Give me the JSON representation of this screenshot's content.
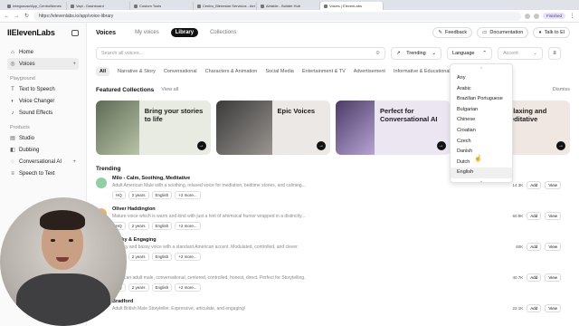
{
  "browser": {
    "tabs": [
      {
        "label": "Integracao/App_CentroBemes"
      },
      {
        "label": "Vapi - Dashboard"
      },
      {
        "label": "Custom Tools"
      },
      {
        "label": "Centro_Bienestar Servicios - Airt"
      },
      {
        "label": "Airtable - Builder Hub"
      },
      {
        "label": "Voices | ElevenLabs"
      }
    ],
    "url": "https://elevenlabs.io/app/voice-library",
    "status_badge": "Finished"
  },
  "sidebar": {
    "brand": "IIElevenLabs",
    "top_items": [
      {
        "label": "Home"
      },
      {
        "label": "Voices"
      }
    ],
    "sections": [
      {
        "label": "Playground",
        "items": [
          {
            "label": "Text to Speech"
          },
          {
            "label": "Voice Changer"
          },
          {
            "label": "Sound Effects"
          }
        ]
      },
      {
        "label": "Products",
        "items": [
          {
            "label": "Studio"
          },
          {
            "label": "Dubbing"
          },
          {
            "label": "Conversational AI"
          },
          {
            "label": "Speech to Text"
          }
        ]
      }
    ]
  },
  "header": {
    "title": "Voices",
    "tabs": [
      {
        "label": "My voices"
      },
      {
        "label": "Library"
      },
      {
        "label": "Collections"
      }
    ],
    "actions": [
      {
        "label": "Feedback"
      },
      {
        "label": "Documentation"
      },
      {
        "label": "Talk to El"
      }
    ]
  },
  "filters": {
    "search_placeholder": "Search all voices...",
    "sort": "Trending",
    "language": "Language",
    "accent": "Accent"
  },
  "categories": [
    "All",
    "Narrative & Story",
    "Conversational",
    "Characters & Animation",
    "Social Media",
    "Entertainment & TV",
    "Advertisement",
    "Informative & Educational"
  ],
  "featured": {
    "title": "Featured Collections",
    "view_all": "View all",
    "dismiss": "Dismiss",
    "cards": [
      {
        "label": "Bring your stories to life",
        "bg": "#e7ebe1"
      },
      {
        "label": "Epic Voices",
        "bg": "#ece8e6"
      },
      {
        "label": "Perfect for Conversational AI",
        "bg": "#ece6f3"
      },
      {
        "label": "Relaxing and Meditative",
        "bg": "#f0e7e2"
      }
    ]
  },
  "trending": {
    "title": "Trending",
    "rows": [
      {
        "name": "Milo - Calm, Soothing, Meditative",
        "desc": "Adult American Male with a soothing, relaxed voice for mediation, bedtime stories, and calming...",
        "tags": [
          "HQ",
          "2 years",
          "English",
          "+2 more..."
        ],
        "usage": "14.3K",
        "add": "Add",
        "view": "View",
        "color": "#8fd1a2"
      },
      {
        "name": "Oliver Haddington",
        "desc": "Mature voice which is warm and kind with just a hint of whimsical humor wrapped in a distinctly...",
        "tags": [
          "HQ",
          "2 years",
          "English",
          "+2 more..."
        ],
        "usage": "60.9K",
        "add": "Add",
        "view": "View",
        "color": "#f2b35a"
      },
      {
        "name": "Husky & Engaging",
        "desc": "A husky and bassy voice with a standard American accent. Modulated, controlled, and clever.",
        "tags": [
          "HQ",
          "2 years",
          "English",
          "+2 more..."
        ],
        "usage": "60K",
        "add": "Add",
        "view": "View",
        "color": "#7cb7e8"
      },
      {
        "name": "Daley",
        "desc": "American adult male, conversational, centered, controlled, honest, direct. Perfect for Storytelling.",
        "tags": [
          "HQ",
          "2 years",
          "English",
          "+2 more..."
        ],
        "usage": "40.7K",
        "add": "Add",
        "view": "View",
        "color": "#d99ad4"
      },
      {
        "name": "Bradford",
        "desc": "Adult British Male Storyteller. Expressive, articulate, and engaging!",
        "tags": [],
        "usage": "22.1K",
        "add": "Add",
        "view": "View",
        "color": "#e7c46a"
      }
    ]
  },
  "language_dropdown": {
    "options": [
      "Any",
      "Arabic",
      "Brazilian Portuguese",
      "Bulgarian",
      "Chinese",
      "Croatian",
      "Czech",
      "Danish",
      "Dutch",
      "English"
    ],
    "highlighted": "English"
  }
}
